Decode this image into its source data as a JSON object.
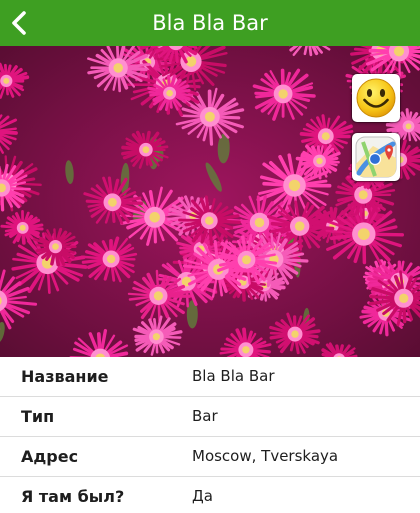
{
  "header": {
    "title": "Bla Bla Bar",
    "back_icon": "chevron-left-icon",
    "background_color": "#3e9f22"
  },
  "photo": {
    "subject": "pink ice plant flowers"
  },
  "actions": {
    "smiley_icon": "smiley-face-icon",
    "maps_icon": "maps-app-icon"
  },
  "details": {
    "rows": [
      {
        "label": "Название",
        "value": "Bla Bla Bar"
      },
      {
        "label": "Тип",
        "value": "Bar"
      },
      {
        "label": "Адрес",
        "value": "Moscow, Tverskaya"
      },
      {
        "label": "Я там был?",
        "value": "Да"
      }
    ]
  }
}
